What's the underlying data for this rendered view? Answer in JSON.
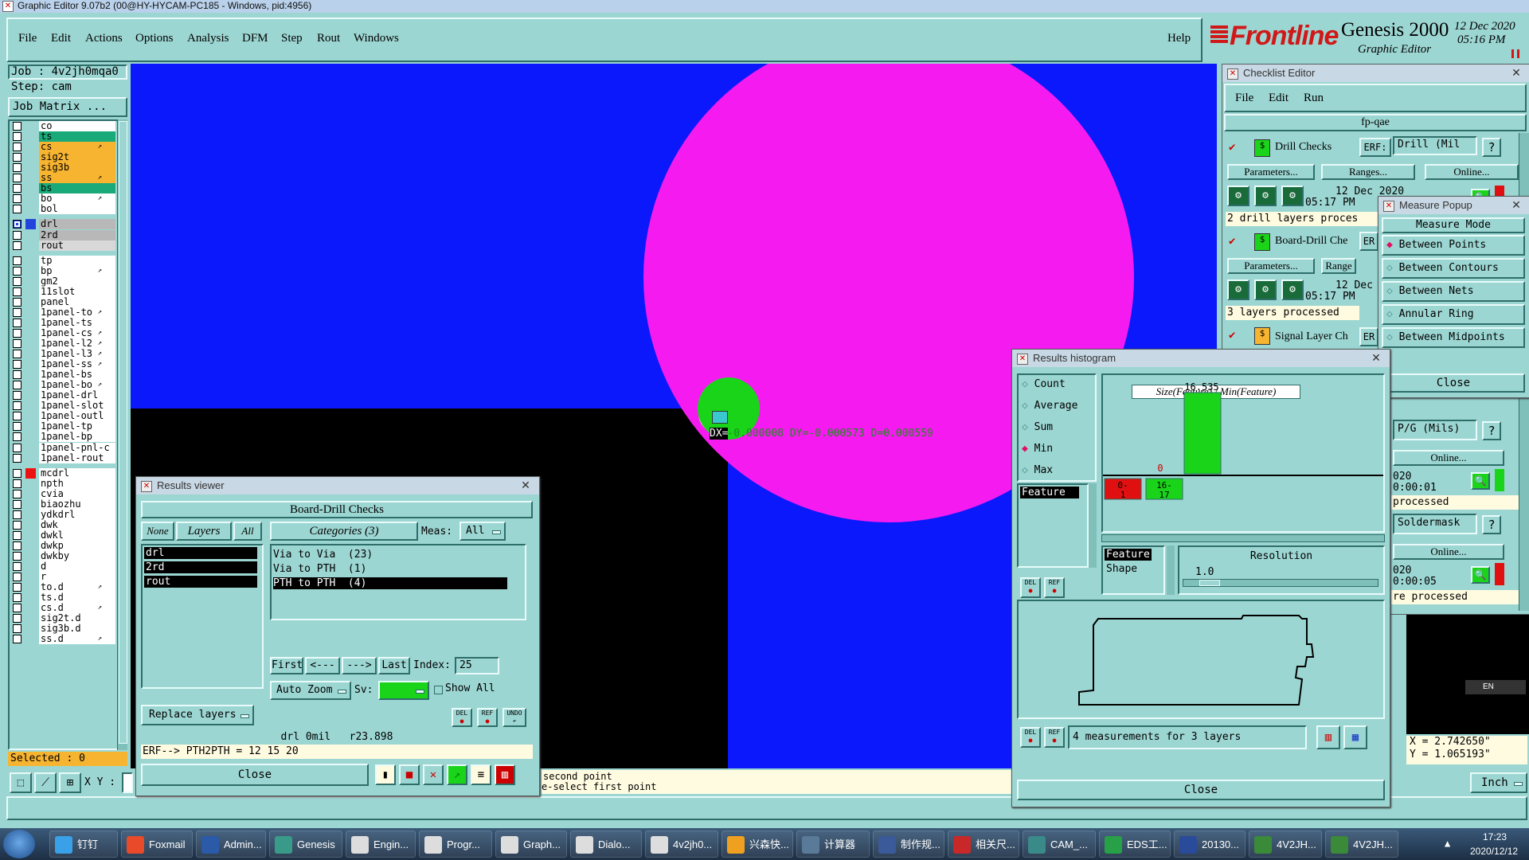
{
  "window_title": "Graphic Editor 9.07b2 (00@HY-HYCAM-PC185 - Windows, pid:4956)",
  "menu": [
    "File",
    "Edit",
    "Actions",
    "Options",
    "Analysis",
    "DFM",
    "Step",
    "Rout",
    "Windows"
  ],
  "help": "Help",
  "brand": {
    "logo": "Frontline",
    "product": "Genesis 2000",
    "sub": "Graphic Editor",
    "date": "12 Dec 2020",
    "time": "05:16 PM"
  },
  "job": {
    "job": "Job : 4v2jh0mqa0",
    "step": "Step: cam",
    "matrix_btn": "Job Matrix ..."
  },
  "layers": [
    {
      "name": "co",
      "color": "#ffffff"
    },
    {
      "name": "ts",
      "color": "#1aaa7a"
    },
    {
      "name": "cs",
      "color": "#f7b431",
      "arrow": true
    },
    {
      "name": "sig2t",
      "color": "#f7b431"
    },
    {
      "name": "sig3b",
      "color": "#f7b431"
    },
    {
      "name": "ss",
      "color": "#f7b431",
      "arrow": true
    },
    {
      "name": "bs",
      "color": "#1aaa7a"
    },
    {
      "name": "bo",
      "color": "#ffffff",
      "arrow": true
    },
    {
      "name": "bol",
      "color": "#ffffff"
    },
    {
      "name": "drl",
      "color": "#b8b8b8",
      "sel": "#2244dd",
      "marker": true
    },
    {
      "name": "2rd",
      "color": "#b8b8b8"
    },
    {
      "name": "rout",
      "color": "#d8d8d8"
    },
    {
      "name": "tp",
      "color": "#ffffff"
    },
    {
      "name": "bp",
      "color": "#ffffff",
      "arrow": true
    },
    {
      "name": "gm2",
      "color": "#ffffff"
    },
    {
      "name": "11slot",
      "color": "#ffffff"
    },
    {
      "name": "panel",
      "color": "#ffffff"
    },
    {
      "name": "1panel-to",
      "color": "#ffffff",
      "arrow": true
    },
    {
      "name": "1panel-ts",
      "color": "#ffffff"
    },
    {
      "name": "1panel-cs",
      "color": "#ffffff",
      "arrow": true
    },
    {
      "name": "1panel-l2",
      "color": "#ffffff",
      "arrow": true
    },
    {
      "name": "1panel-l3",
      "color": "#ffffff",
      "arrow": true
    },
    {
      "name": "1panel-ss",
      "color": "#ffffff",
      "arrow": true
    },
    {
      "name": "1panel-bs",
      "color": "#ffffff"
    },
    {
      "name": "1panel-bo",
      "color": "#ffffff",
      "arrow": true
    },
    {
      "name": "1panel-drl",
      "color": "#ffffff"
    },
    {
      "name": "1panel-slot",
      "color": "#ffffff"
    },
    {
      "name": "1panel-outl",
      "color": "#ffffff"
    },
    {
      "name": "1panel-tp",
      "color": "#ffffff"
    },
    {
      "name": "1panel-bp",
      "color": "#ffffff"
    },
    {
      "name": "1panel-pnl-c",
      "color": "#ffffff"
    },
    {
      "name": "1panel-rout",
      "color": "#ffffff"
    },
    {
      "name": "mcdrl",
      "color": "#ffffff",
      "sel": "#ee1111"
    },
    {
      "name": "npth",
      "color": "#ffffff"
    },
    {
      "name": "cvia",
      "color": "#ffffff"
    },
    {
      "name": "biaozhu",
      "color": "#ffffff"
    },
    {
      "name": "ydkdrl",
      "color": "#ffffff"
    },
    {
      "name": "dwk",
      "color": "#ffffff"
    },
    {
      "name": "dwkl",
      "color": "#ffffff"
    },
    {
      "name": "dwkp",
      "color": "#ffffff"
    },
    {
      "name": "dwkby",
      "color": "#ffffff"
    },
    {
      "name": "d",
      "color": "#ffffff"
    },
    {
      "name": "r",
      "color": "#ffffff"
    },
    {
      "name": "to.d",
      "color": "#ffffff",
      "arrow": true
    },
    {
      "name": "ts.d",
      "color": "#ffffff"
    },
    {
      "name": "cs.d",
      "color": "#ffffff",
      "arrow": true
    },
    {
      "name": "sig2t.d",
      "color": "#ffffff"
    },
    {
      "name": "sig3b.d",
      "color": "#ffffff"
    },
    {
      "name": "ss.d",
      "color": "#ffffff",
      "arrow": true
    }
  ],
  "selected": "Selected : 0",
  "xy_label": "X Y :",
  "canvas": {
    "measure_text": "DX=-0.000008 DY=-0.000573 D=0.000559"
  },
  "status": {
    "line1": "second point",
    "line2": "e-select first point"
  },
  "results_viewer": {
    "title": "Results viewer",
    "header": "Board-Drill Checks",
    "none": "None",
    "layers": "Layers",
    "all": "All",
    "categories": "Categories (3)",
    "meas": "Meas:",
    "meas_val": "All",
    "layer_list": [
      "drl",
      "2rd",
      "rout"
    ],
    "cat_list": [
      "Via to Via  (23)",
      "Via to PTH  (1)",
      "PTH to PTH  (4)"
    ],
    "first": "First",
    "prev": "<---",
    "next": "--->",
    "last": "Last",
    "index_label": "Index:",
    "index_val": "25",
    "auto_zoom": "Auto Zoom",
    "sv": "Sv:",
    "show_all": "Show All",
    "replace": "Replace layers",
    "del": "DEL",
    "ref": "REF",
    "undo": "UNDO",
    "info": "drl 0mil   r23.898",
    "erf": "ERF--> PTH2PTH = 12 15 20",
    "close": "Close"
  },
  "checklist": {
    "title": "Checklist Editor",
    "menu": [
      "File",
      "Edit",
      "Run"
    ],
    "name": "fp-qae",
    "drill": {
      "label": "Drill Checks",
      "erf": "ERF:",
      "erf_val": "Drill (Mil",
      "params": "Parameters...",
      "ranges": "Ranges...",
      "online": "Online...",
      "date": "12 Dec 2020",
      "time": "05:17 PM",
      "msg": "2 drill layers proces"
    },
    "board": {
      "label": "Board-Drill Che",
      "erf": "ER",
      "params": "Parameters...",
      "ranges": "Range",
      "date": "12 Dec",
      "time": "05:17 PM",
      "msg": "3 layers processed"
    },
    "signal": {
      "label": "Signal Layer Ch",
      "erf": "ER",
      "params": "Parameters..."
    },
    "right": {
      "pg": "P/G (Mils)",
      "online": "Online...",
      "t1a": "020",
      "t1b": "0:00:01",
      "msg1": "processed",
      "sm": "Soldermask",
      "online2": "Online...",
      "t2a": "020",
      "t2b": "0:00:05",
      "msg2": "re processed"
    }
  },
  "measure_popup": {
    "title": "Measure Popup",
    "mode": "Measure Mode",
    "options": [
      "Between Points",
      "Between Contours",
      "Between Nets",
      "Annular Ring",
      "Between Midpoints"
    ],
    "close": "Close"
  },
  "histogram": {
    "title": "Results histogram",
    "radios": [
      "Count",
      "Average",
      "Sum",
      "Min",
      "Max"
    ],
    "selected": "Min",
    "list_item": "Feature",
    "axis_title": "Size(Feature) / Min(Feature)",
    "bar_value": "16.535",
    "zero": "0",
    "bins": [
      "0-\n1",
      "16-\n17"
    ],
    "feature": "Feature",
    "shape": "Shape",
    "resolution": "Resolution",
    "res_val": "1.0",
    "del": "DEL",
    "ref": "REF",
    "msg": "4 measurements for 3 layers",
    "close": "Close"
  },
  "chart_data": {
    "type": "bar",
    "title": "Size(Feature) / Min(Feature)",
    "categories": [
      "0-1",
      "16-17"
    ],
    "values": [
      0,
      16.535
    ]
  },
  "coords": {
    "x": "X = 2.742650\"",
    "y": "Y = 1.065193\"",
    "unit": "Inch"
  },
  "taskbar": {
    "items": [
      "钉钉",
      "Foxmail",
      "Admin...",
      "Genesis",
      "Engin...",
      "Progr...",
      "Graph...",
      "Dialo...",
      "4v2jh0...",
      "兴森快...",
      "计算器",
      "制作规...",
      "相关尺...",
      "CAM_...",
      "EDS工...",
      "20130...",
      "4V2JH...",
      "4V2JH..."
    ],
    "time": "17:23",
    "date": "2020/12/12",
    "lang": "EN"
  }
}
